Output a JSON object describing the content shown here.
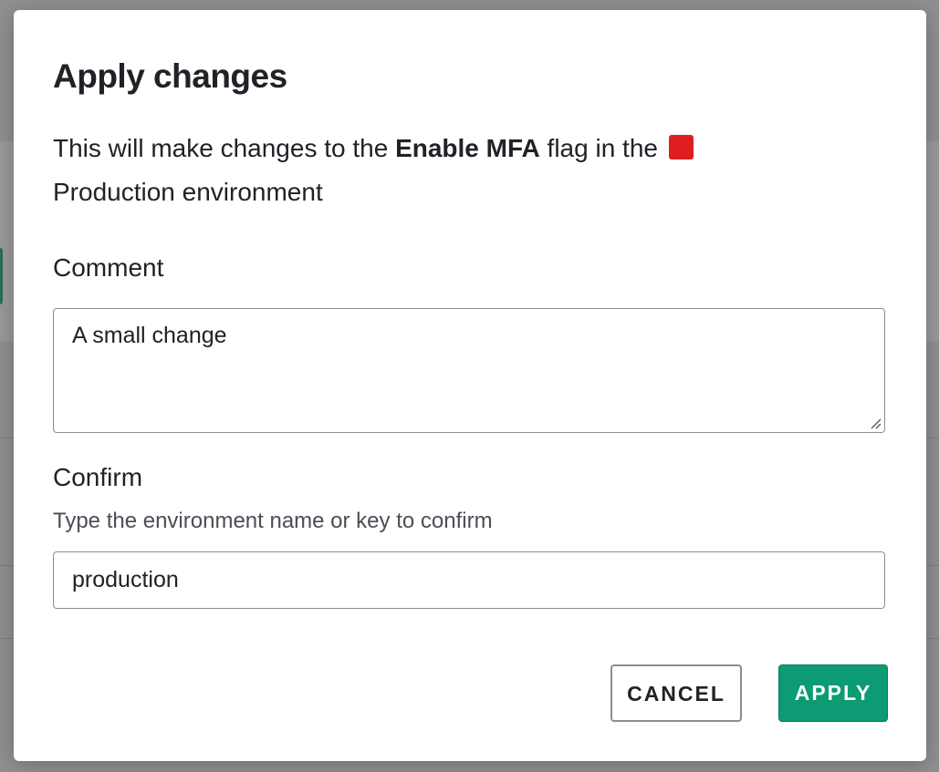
{
  "dialog": {
    "title": "Apply changes",
    "description_prefix": "This will make changes to the ",
    "flag_name": "Enable MFA",
    "description_middle": " flag in the",
    "environment_name": "Production environment",
    "environment_color": "#dd1f1f"
  },
  "comment": {
    "label": "Comment",
    "value": "A small change"
  },
  "confirm": {
    "label": "Confirm",
    "hint": "Type the environment name or key to confirm",
    "value": "production"
  },
  "actions": {
    "cancel_label": "CANCEL",
    "apply_label": "APPLY",
    "apply_color": "#0c9b73"
  }
}
